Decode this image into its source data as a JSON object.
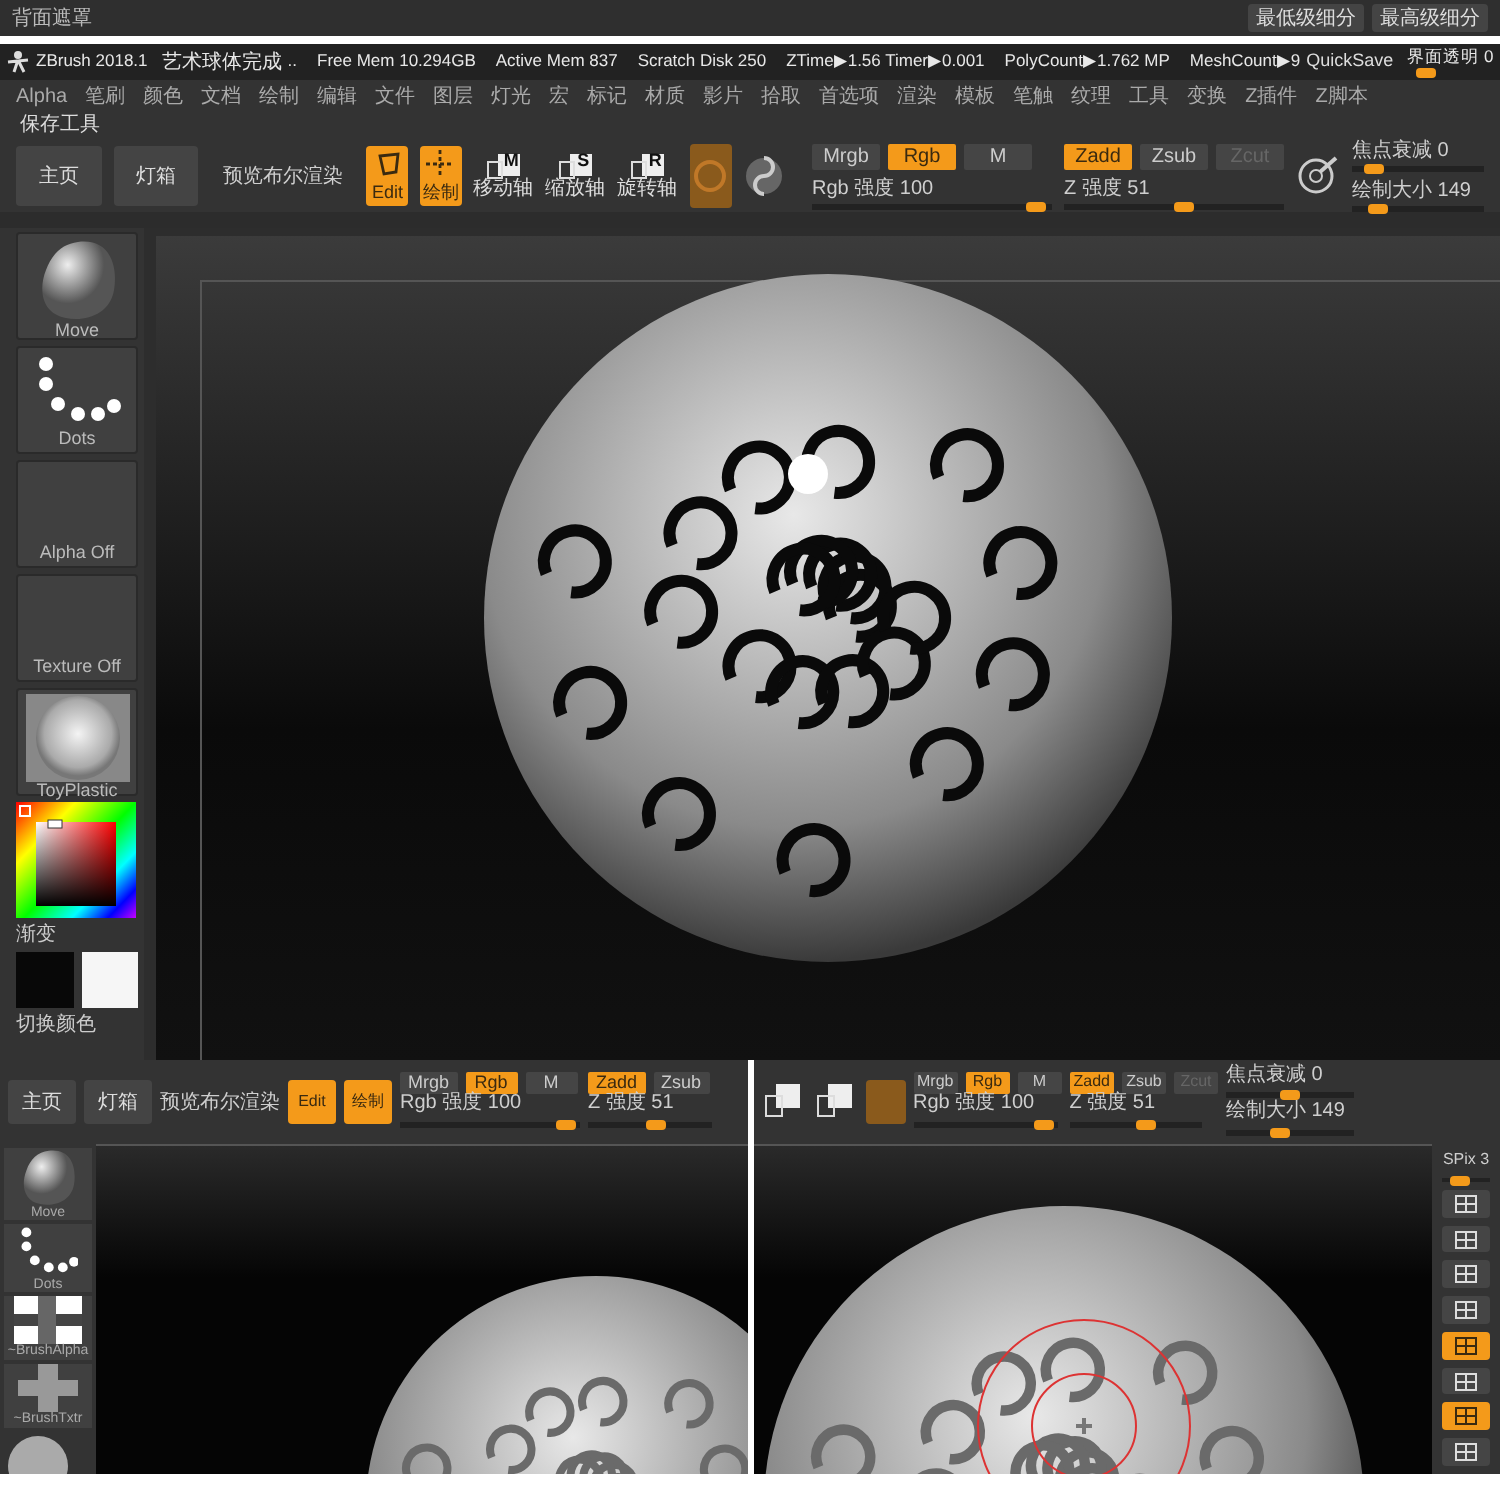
{
  "top_strip": {
    "left_label": "背面遮罩",
    "right_buttons": [
      "最低级细分",
      "最高级细分"
    ]
  },
  "title_bar": {
    "app": "ZBrush 2018.1",
    "document": "艺术球体完成",
    "ellipsis": "..",
    "stats": [
      "Free Mem 10.294GB",
      "Active Mem 837",
      "Scratch Disk 250",
      "ZTime▶1.56 Timer▶0.001",
      "PolyCount▶1.762 MP",
      "MeshCount▶9"
    ],
    "quicksave": "QuickSave",
    "opacity": {
      "label": "界面透明 0",
      "level": 0.1
    }
  },
  "menu": [
    "Alpha",
    "笔刷",
    "颜色",
    "文档",
    "绘制",
    "编辑",
    "文件",
    "图层",
    "灯光",
    "宏",
    "标记",
    "材质",
    "影片",
    "拾取",
    "首选项",
    "渲染",
    "模板",
    "笔触",
    "纹理",
    "工具",
    "变换",
    "Z插件",
    "Z脚本"
  ],
  "tool_label": "保存工具",
  "toolbar": {
    "buttons": [
      "主页",
      "灯箱"
    ],
    "preview": "预览布尔渲染",
    "modes": [
      {
        "label": "Edit",
        "on": true
      },
      {
        "label": "绘制",
        "on": true
      }
    ],
    "transforms": [
      {
        "letter": "M",
        "label": "移动轴"
      },
      {
        "letter": "S",
        "label": "缩放轴"
      },
      {
        "letter": "R",
        "label": "旋转轴"
      }
    ],
    "rgb_modes": [
      {
        "label": "Mrgb",
        "selected": false,
        "disabled": false
      },
      {
        "label": "Rgb",
        "selected": true,
        "disabled": false
      },
      {
        "label": "M",
        "selected": false,
        "disabled": false
      }
    ],
    "rgb_intensity": {
      "label": "Rgb 强度 100",
      "level": 0.97
    },
    "z_modes": [
      {
        "label": "Zadd",
        "selected": true,
        "disabled": false
      },
      {
        "label": "Zsub",
        "selected": false,
        "disabled": false
      },
      {
        "label": "Zcut",
        "selected": false,
        "disabled": true
      }
    ],
    "z_intensity": {
      "label": "Z 强度 51",
      "level": 0.55
    },
    "focal": {
      "label": "焦点衰减 0",
      "level": 0.1
    },
    "draw_size": {
      "label": "绘制大小 149",
      "level": 0.15
    }
  },
  "left_tray": [
    {
      "label": "Move",
      "kind": "brush"
    },
    {
      "label": "Dots",
      "kind": "stroke"
    },
    {
      "label": "Alpha Off",
      "kind": "empty"
    },
    {
      "label": "Texture Off",
      "kind": "empty"
    },
    {
      "label": "ToyPlastic",
      "kind": "material"
    }
  ],
  "color_picker": {
    "gradient_label": "渐变",
    "switch_label": "切换颜色"
  },
  "bottom_left": {
    "buttons": [
      "主页",
      "灯箱"
    ],
    "preview": "预览布尔渲染",
    "modes": [
      {
        "label": "Edit",
        "on": true
      },
      {
        "label": "绘制",
        "on": true
      }
    ],
    "rgb_modes": [
      {
        "label": "Mrgb",
        "selected": false
      },
      {
        "label": "Rgb",
        "selected": true
      },
      {
        "label": "M",
        "selected": false
      }
    ],
    "rgb_intensity": {
      "label": "Rgb 强度 100",
      "level": 0.97
    },
    "z_modes": [
      {
        "label": "Zadd",
        "selected": true
      },
      {
        "label": "Zsub",
        "selected": false
      }
    ],
    "z_intensity": {
      "label": "Z 强度 51",
      "level": 0.55
    },
    "tray": [
      {
        "label": "Move",
        "kind": "brush"
      },
      {
        "label": "Dots",
        "kind": "stroke"
      },
      {
        "label": "~BrushAlpha",
        "kind": "alpha"
      },
      {
        "label": "~BrushTxtr",
        "kind": "texture"
      }
    ]
  },
  "bottom_right": {
    "rgb_modes": [
      {
        "label": "Mrgb",
        "selected": false,
        "disabled": false
      },
      {
        "label": "Rgb",
        "selected": true,
        "disabled": false
      },
      {
        "label": "M",
        "selected": false,
        "disabled": false
      }
    ],
    "rgb_intensity": {
      "label": "Rgb 强度 100",
      "level": 0.97
    },
    "z_modes": [
      {
        "label": "Zadd",
        "selected": true,
        "disabled": false
      },
      {
        "label": "Zsub",
        "selected": false,
        "disabled": false
      },
      {
        "label": "Zcut",
        "selected": false,
        "disabled": true
      }
    ],
    "z_intensity": {
      "label": "Z 强度 51",
      "level": 0.6
    },
    "focal": {
      "label": "焦点衰减 0",
      "level": 0.5
    },
    "draw_size": {
      "label": "绘制大小 149",
      "level": 0.4
    },
    "spix": {
      "label": "SPix 3",
      "level": 0.3
    },
    "shelf": [
      {
        "on": false
      },
      {
        "on": false
      },
      {
        "on": false
      },
      {
        "on": false
      },
      {
        "on": true
      },
      {
        "on": false
      },
      {
        "on": true
      },
      {
        "on": false
      }
    ]
  }
}
